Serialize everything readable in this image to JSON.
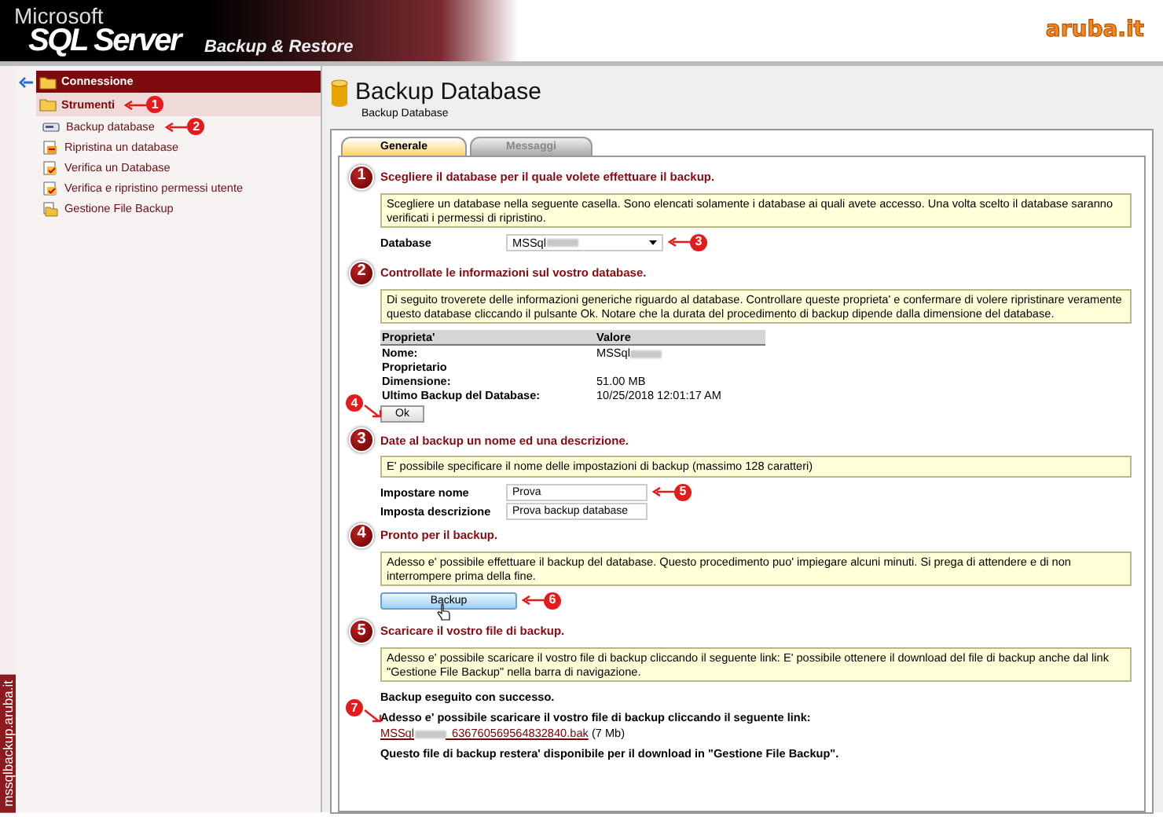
{
  "header": {
    "brand_small": "Microsoft",
    "brand": "SQL Server",
    "product": "Backup & Restore",
    "logo": "aruba.it"
  },
  "sidebar": {
    "sections": [
      {
        "label": "Connessione",
        "kind": "header"
      },
      {
        "label": "Strumenti",
        "kind": "group",
        "callout": "1",
        "items": [
          {
            "label": "Backup database",
            "kind": "backup",
            "callout": "2"
          },
          {
            "label": "Ripristina un database",
            "kind": "restore"
          },
          {
            "label": "Verifica un Database",
            "kind": "verify"
          },
          {
            "label": "Verifica e ripristino permessi utente",
            "kind": "verify"
          },
          {
            "label": "Gestione File Backup",
            "kind": "files"
          }
        ]
      }
    ],
    "vertical_label": "mssqlbackup.aruba.it"
  },
  "page": {
    "title": "Backup Database",
    "breadcrumb": "Backup Database"
  },
  "tabs": [
    {
      "label": "Generale",
      "selected": true
    },
    {
      "label": "Messaggi",
      "selected": false
    }
  ],
  "steps": [
    {
      "number": "1",
      "title": "Scegliere il database per il quale volete effettuare il backup.",
      "info": "Scegliere un database nella seguente casella. Sono elencati solamente i database ai quali avete accesso. Una volta scelto il database saranno verificati i permessi di ripristino.",
      "fields": [
        {
          "label": "Database",
          "kind": "select",
          "value": "MSSql",
          "redacted": true,
          "callout": "3"
        }
      ]
    },
    {
      "number": "2",
      "title": "Controllate le informazioni sul vostro database.",
      "info": "Di seguito troverete delle informazioni generiche riguardo al database. Controllare queste proprieta' e confermare di volere ripristinare veramente questo database cliccando il pulsante Ok. Notare che la durata del procedimento di backup dipende dalla dimensione del database.",
      "table": {
        "columns": [
          "Proprieta'",
          "Valore"
        ],
        "rows": [
          {
            "name": "Nome:",
            "value": "MSSql",
            "redacted": true
          },
          {
            "name": "Proprietario"
          },
          {
            "name": "Dimensione:",
            "value": "51.00 MB"
          },
          {
            "name": "Ultimo Backup del Database:",
            "value": "10/25/2018 12:01:17 AM"
          }
        ]
      },
      "button": {
        "label": "Ok",
        "kind": "plain",
        "callout": "4"
      }
    },
    {
      "number": "3",
      "title": "Date al backup un nome ed una descrizione.",
      "info": "E' possibile specificare il nome delle impostazioni di backup (massimo 128 caratteri)",
      "fields": [
        {
          "label": "Impostare nome",
          "kind": "text",
          "value": "Prova",
          "callout": "5"
        },
        {
          "label": "Imposta descrizione",
          "kind": "text",
          "value": "Prova backup database"
        }
      ]
    },
    {
      "number": "4",
      "title": "Pronto per il backup.",
      "info": "Adesso e' possibile effettuare il backup del database. Questo procedimento puo' impiegare alcuni minuti. Si prega di attendere e di non interrompere prima della fine.",
      "button": {
        "label": "Backup",
        "kind": "primary",
        "callout": "6",
        "hovered": true
      }
    },
    {
      "number": "5",
      "title": "Scaricare il vostro file di backup.",
      "info": "Adesso e' possibile scaricare il vostro file di backup cliccando il seguente link: E' possibile ottenere il download del file di backup anche dal link \"Gestione File Backup\" nella barra di navigazione.",
      "result": {
        "status": "Backup eseguito con successo.",
        "prompt": "Adesso e' possibile scaricare il vostro file di backup cliccando il seguente link:",
        "callout": "7",
        "link": {
          "prefix": "MSSql",
          "suffix": "_636760569564832840.bak",
          "redacted": true
        },
        "size": "(7 Mb)",
        "note": "Questo file di backup restera' disponibile per il download in \"Gestione File Backup\"."
      }
    }
  ]
}
